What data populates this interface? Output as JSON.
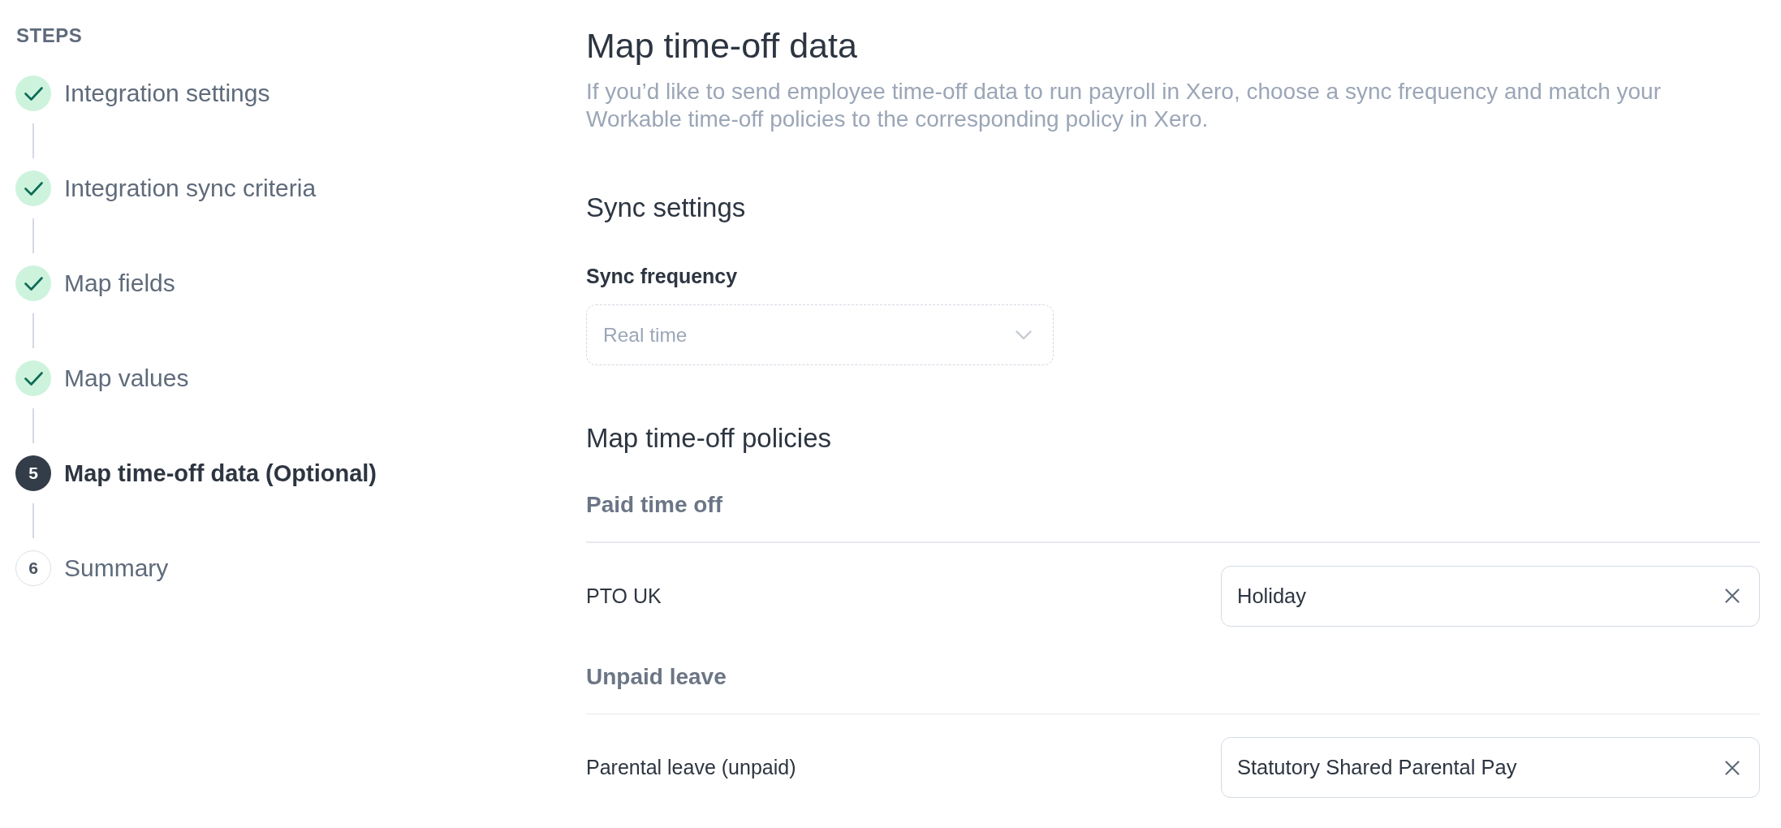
{
  "sidebar": {
    "heading": "STEPS",
    "steps": [
      {
        "label": "Integration settings",
        "completed": true,
        "selected": false
      },
      {
        "label": "Integration sync criteria",
        "completed": true,
        "selected": false
      },
      {
        "label": "Map fields",
        "completed": true,
        "selected": false
      },
      {
        "label": "Map values",
        "completed": true,
        "selected": false
      },
      {
        "number": "5",
        "label": "Map time-off data (Optional)",
        "completed": false,
        "selected": true
      },
      {
        "number": "6",
        "label": "Summary",
        "completed": false,
        "selected": false
      }
    ]
  },
  "header": {
    "title": "Map time-off data",
    "description": "If you’d like to send employee time-off data to run payroll in Xero, choose a sync frequency and match your Workable time-off policies to the corresponding policy in Xero."
  },
  "sync_settings": {
    "heading": "Sync settings",
    "field": {
      "label": "Sync frequency",
      "value": "Real time",
      "disabled": true
    }
  },
  "policies": {
    "heading": "Map time-off policies",
    "groups": [
      {
        "name": "Paid time off",
        "rows": [
          {
            "label": "PTO UK",
            "value": "Holiday"
          }
        ]
      },
      {
        "name": "Unpaid leave",
        "rows": [
          {
            "label": "Parental leave (unpaid)",
            "value": "Statutory Shared Parental Pay"
          }
        ]
      }
    ]
  }
}
